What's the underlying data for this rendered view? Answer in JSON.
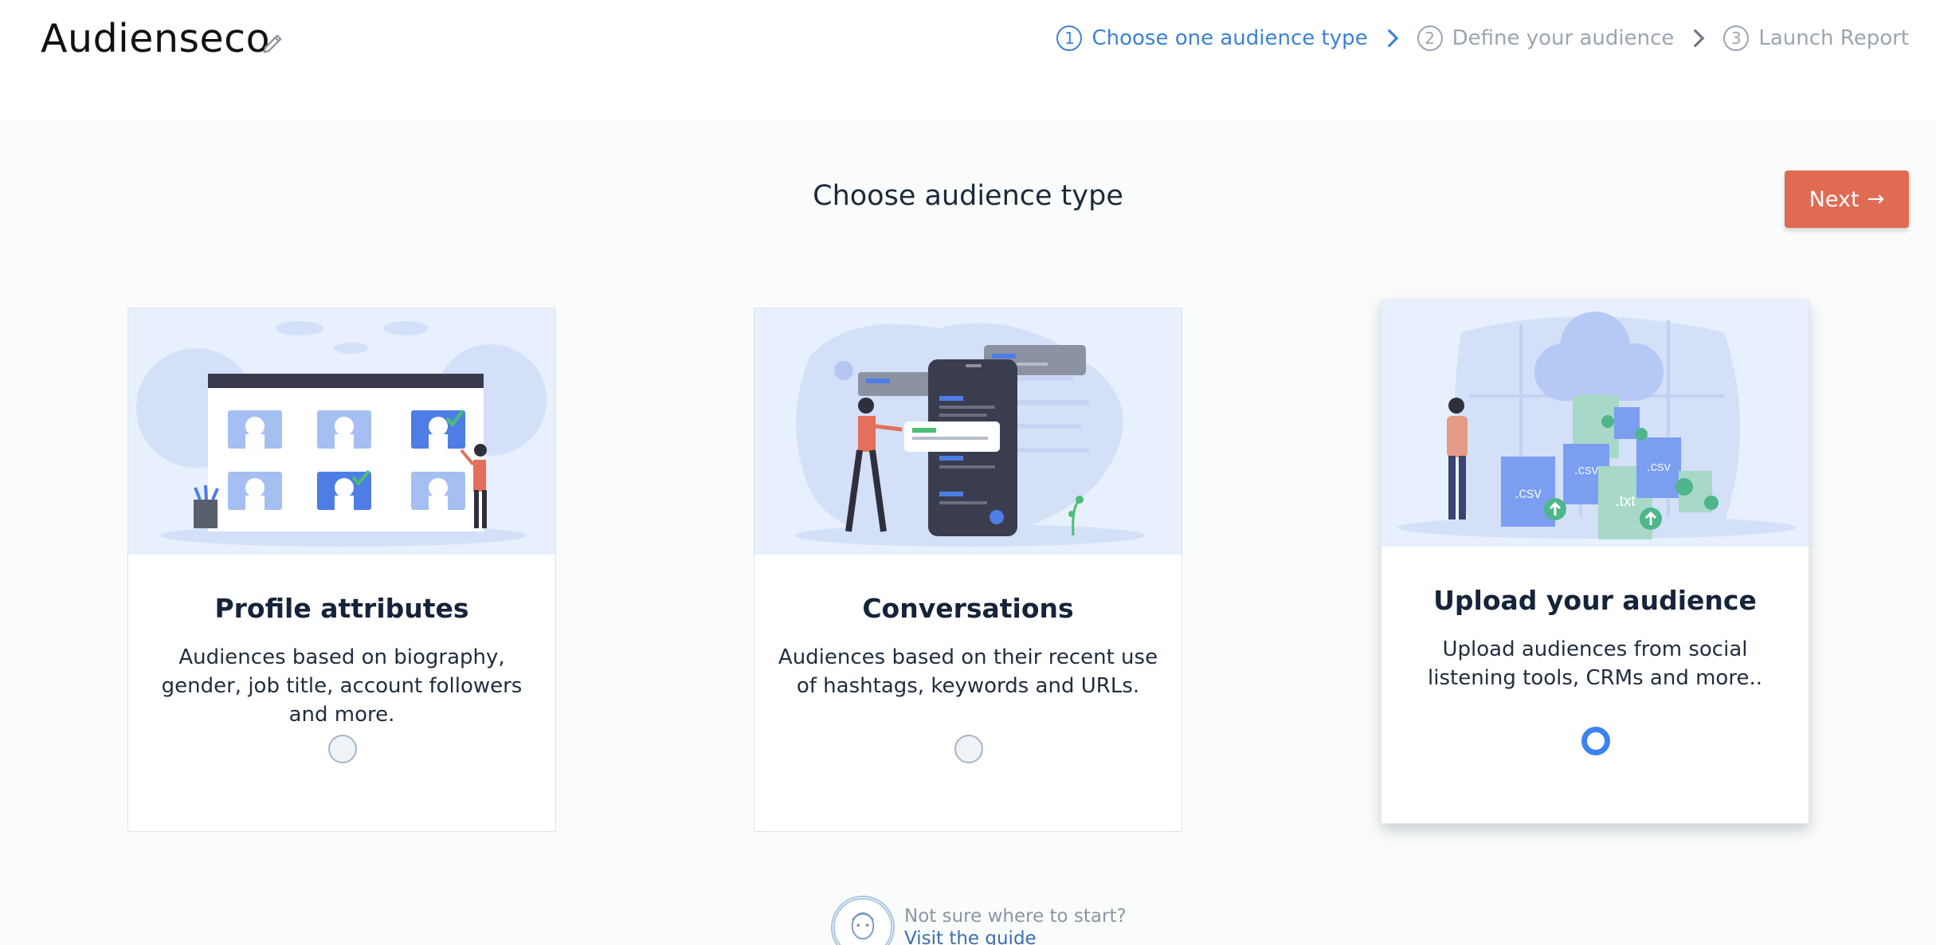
{
  "header": {
    "app_title": "Audienseco",
    "steps": [
      {
        "number": "1",
        "label": "Choose one audience type",
        "active": true
      },
      {
        "number": "2",
        "label": "Define your audience",
        "active": false
      },
      {
        "number": "3",
        "label": "Launch Report",
        "active": false
      }
    ]
  },
  "main": {
    "heading": "Choose audience type",
    "next_label": "Next",
    "cards": [
      {
        "title": "Profile attributes",
        "description": "Audiences based on biography, gender, job title, account followers and more.",
        "selected": false
      },
      {
        "title": "Conversations",
        "description": "Audiences based on their recent use of hashtags, keywords and URLs.",
        "selected": false
      },
      {
        "title": "Upload your audience",
        "description": "Upload audiences from social listening tools, CRMs and more..",
        "selected": true
      }
    ],
    "illustration_labels": {
      "csv": ".csv",
      "txt": ".txt"
    }
  },
  "help": {
    "prompt": "Not sure where to start?",
    "link": "Visit the guide"
  },
  "colors": {
    "accent_blue": "#3b82d6",
    "next_button": "#e06b52",
    "step_inactive": "#9aa5b1"
  }
}
